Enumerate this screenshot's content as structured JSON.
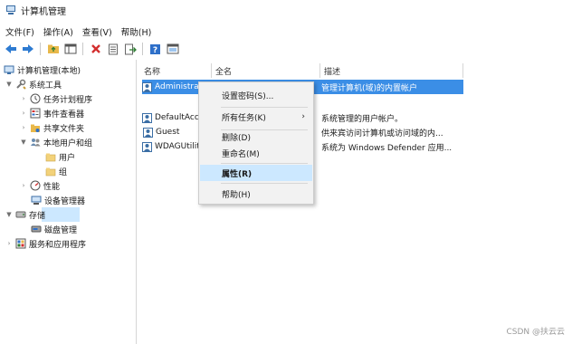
{
  "window": {
    "title": "计算机管理",
    "watermark": "CSDN @扶云云"
  },
  "menubar": {
    "items": [
      "文件(F)",
      "操作(A)",
      "查看(V)",
      "帮助(H)"
    ]
  },
  "toolbar": {
    "icons": [
      "back-arrow-icon",
      "forward-arrow-icon",
      "up-folder-icon",
      "show-pane-icon",
      "delete-icon",
      "properties-icon",
      "export-icon",
      "help-icon",
      "console-tree-icon"
    ]
  },
  "tree": {
    "items": [
      {
        "label": "计算机管理(本地)"
      },
      {
        "label": "系统工具"
      },
      {
        "label": "任务计划程序"
      },
      {
        "label": "事件查看器"
      },
      {
        "label": "共享文件夹"
      },
      {
        "label": "本地用户和组"
      },
      {
        "label": "用户"
      },
      {
        "label": "组"
      },
      {
        "label": "性能"
      },
      {
        "label": "设备管理器"
      },
      {
        "label": "存储"
      },
      {
        "label": "磁盘管理"
      },
      {
        "label": "服务和应用程序"
      }
    ]
  },
  "list": {
    "headers": {
      "name": "名称",
      "fullname": "全名",
      "description": "描述"
    },
    "rows": [
      {
        "name": "Administrator",
        "fullname": "",
        "description": "管理计算机(域)的内置帐户"
      },
      {
        "name": "DefaultAccount",
        "fullname": "",
        "description": "系统管理的用户帐户。"
      },
      {
        "name": "Guest",
        "fullname": "",
        "description": "供来宾访问计算机或访问域的内..."
      },
      {
        "name": "WDAGUtilityAccount",
        "fullname": "",
        "description": "系统为 Windows Defender 应用..."
      }
    ]
  },
  "context_menu": {
    "items": [
      {
        "label": "设置密码(S)..."
      },
      {
        "label": "所有任务(K)",
        "submenu": "›"
      },
      {
        "label": "删除(D)"
      },
      {
        "label": "重命名(M)"
      },
      {
        "label": "属性(R)"
      },
      {
        "label": "帮助(H)"
      }
    ]
  },
  "colors": {
    "selection": "#3b8ee6",
    "hover": "#cce8ff",
    "menu_bg": "#f2f2f2"
  }
}
